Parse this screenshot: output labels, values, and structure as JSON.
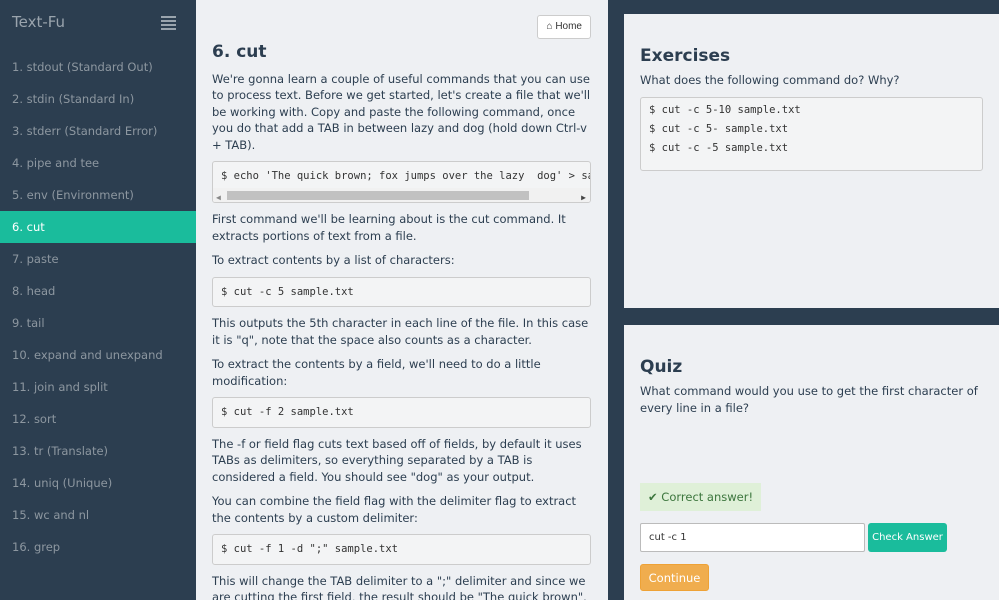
{
  "sidebar": {
    "title": "Text-Fu",
    "items": [
      "1. stdout (Standard Out)",
      "2. stdin (Standard In)",
      "3. stderr (Standard Error)",
      "4. pipe and tee",
      "5. env (Environment)",
      "6. cut",
      "7. paste",
      "8. head",
      "9. tail",
      "10. expand and unexpand",
      "11. join and split",
      "12. sort",
      "13. tr (Translate)",
      "14. uniq (Unique)",
      "15. wc and nl",
      "16. grep"
    ],
    "active_index": 5
  },
  "main": {
    "home_label": "Home",
    "title": "6. cut",
    "p1": "We're gonna learn a couple of useful commands that you can use to process text. Before we get started, let's create a file that we'll be working with. Copy and paste the following command, once you do that add a TAB in between lazy and dog (hold down Ctrl-v + TAB).",
    "code1": "$ echo 'The quick brown; fox jumps over the lazy  dog' > sample.txt",
    "p2": "First command we'll be learning about is the cut command. It extracts portions of text from a file.",
    "p3": "To extract contents by a list of characters:",
    "code2": "$ cut -c 5 sample.txt",
    "p4": "This outputs the 5th character in each line of the file. In this case it is \"q\", note that the space also counts as a character.",
    "p5": "To extract the contents by a field, we'll need to do a little modification:",
    "code3": "$ cut -f 2 sample.txt",
    "p6": "The -f or field flag cuts text based off of fields, by default it uses TABs as delimiters, so everything separated by a TAB is considered a field. You should see \"dog\" as your output.",
    "p7": "You can combine the field flag with the delimiter flag to extract the contents by a custom delimiter:",
    "code4": "$ cut -f 1 -d \";\" sample.txt",
    "p8": "This will change the TAB delimiter to a \";\" delimiter and since we are cutting the first field, the result should be \"The quick brown\"."
  },
  "exercises": {
    "title": "Exercises",
    "question": "What does the following command do? Why?",
    "commands": [
      "$ cut -c 5-10 sample.txt",
      "$ cut -c 5- sample.txt",
      "$ cut -c -5 sample.txt"
    ]
  },
  "quiz": {
    "title": "Quiz",
    "question": "What command would you use to get the first character of every line in a file?",
    "alert": "Correct answer!",
    "answer_value": "cut -c 1",
    "check_label": "Check Answer",
    "continue_label": "Continue"
  }
}
